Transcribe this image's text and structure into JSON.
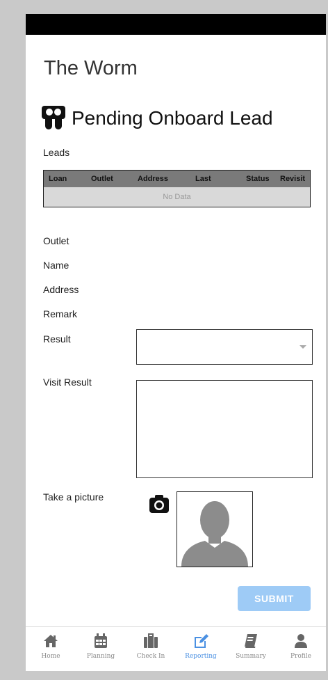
{
  "app": {
    "title": "The Worm"
  },
  "section": {
    "title": "Pending Onboard Lead",
    "icon": "lead-icon"
  },
  "leads": {
    "label": "Leads",
    "columns": [
      "Loan",
      "Outlet",
      "Address",
      "Last",
      "Status",
      "Revisit"
    ],
    "empty_text": "No Data"
  },
  "form": {
    "outlet_label": "Outlet",
    "name_label": "Name",
    "address_label": "Address",
    "remark_label": "Remark",
    "result_label": "Result",
    "result_value": "",
    "visit_result_label": "Visit Result",
    "visit_result_value": "",
    "picture_label": "Take a picture",
    "submit_label": "SUBMIT"
  },
  "nav": {
    "items": [
      {
        "label": "Home",
        "icon": "home-icon",
        "active": false
      },
      {
        "label": "Planning",
        "icon": "calendar-icon",
        "active": false
      },
      {
        "label": "Check In",
        "icon": "luggage-icon",
        "active": false
      },
      {
        "label": "Reporting",
        "icon": "edit-icon",
        "active": true
      },
      {
        "label": "Summary",
        "icon": "book-icon",
        "active": false
      },
      {
        "label": "Profile",
        "icon": "user-icon",
        "active": false
      }
    ]
  },
  "colors": {
    "accent": "#4a90e2",
    "submit_disabled": "#9ecbf6",
    "table_header": "#7a7a7a",
    "table_body": "#d9d9d9",
    "icon_gray": "#666666"
  }
}
